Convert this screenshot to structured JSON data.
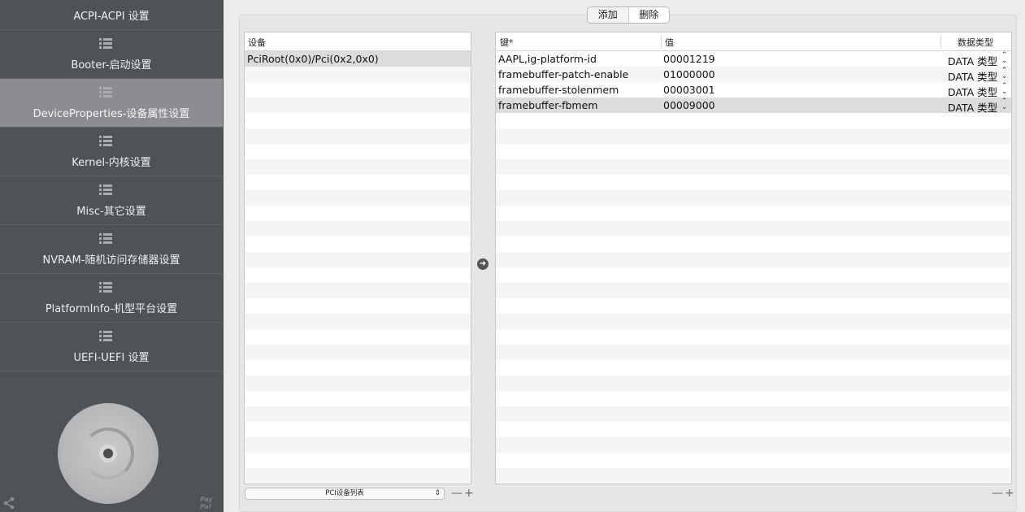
{
  "sidebar": {
    "items": [
      {
        "label": "ACPI-ACPI 设置",
        "icon": "list-icon"
      },
      {
        "label": "Booter-启动设置",
        "icon": "list-icon"
      },
      {
        "label": "DeviceProperties-设备属性设置",
        "icon": "list-icon",
        "active": true
      },
      {
        "label": "Kernel-内核设置",
        "icon": "list-icon"
      },
      {
        "label": "Misc-其它设置",
        "icon": "list-icon"
      },
      {
        "label": "NVRAM-随机访问存储器设置",
        "icon": "list-icon"
      },
      {
        "label": "PlatformInfo-机型平台设置",
        "icon": "list-icon"
      },
      {
        "label": "UEFI-UEFI 设置",
        "icon": "list-icon"
      }
    ],
    "paypal_line1": "Pay",
    "paypal_line2": "Pal"
  },
  "toolbar": {
    "add_label": "添加",
    "delete_label": "删除"
  },
  "device_table": {
    "header": "设备",
    "rows": [
      "PciRoot(0x0)/Pci(0x2,0x0)"
    ],
    "popup_label": "PCI设备列表",
    "minus": "—",
    "plus": "+"
  },
  "props_table": {
    "headers": {
      "key": "键*",
      "value": "值",
      "type": "数据类型"
    },
    "rows": [
      {
        "key": "AAPL,ig-platform-id",
        "value": "00001219",
        "type": "DATA 类型"
      },
      {
        "key": "framebuffer-patch-enable",
        "value": "01000000",
        "type": "DATA 类型"
      },
      {
        "key": "framebuffer-stolenmem",
        "value": "00003001",
        "type": "DATA 类型"
      },
      {
        "key": "framebuffer-fbmem",
        "value": "00009000",
        "type": "DATA 类型"
      }
    ],
    "minus": "—",
    "plus": "+"
  },
  "colors": {
    "sidebar_bg": "#505356",
    "sidebar_active": "#8b8d90",
    "panel_bg": "#e6e6e6"
  }
}
